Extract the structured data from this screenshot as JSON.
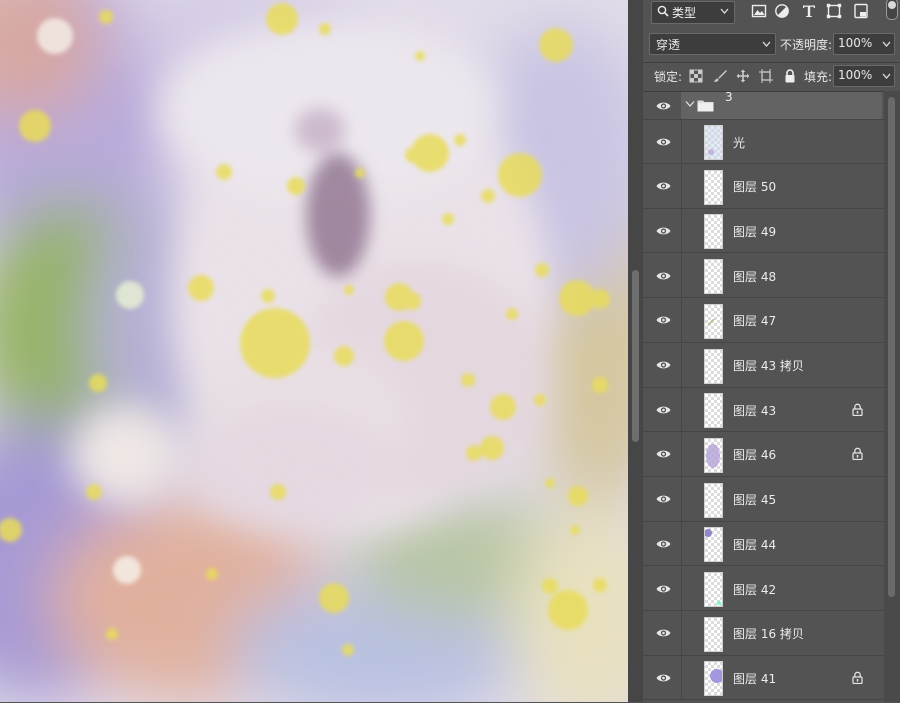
{
  "filter": {
    "label": "类型"
  },
  "blend": {
    "mode": "穿透"
  },
  "opacity": {
    "label": "不透明度:",
    "value": "100%"
  },
  "lock": {
    "label": "锁定:"
  },
  "fill": {
    "label": "填充:",
    "value": "100%"
  },
  "group": {
    "name": "3"
  },
  "layers": [
    {
      "name": "光",
      "locked": false
    },
    {
      "name": "图层 50",
      "locked": false
    },
    {
      "name": "图层 49",
      "locked": false
    },
    {
      "name": "图层 48",
      "locked": false
    },
    {
      "name": "图层 47",
      "locked": false
    },
    {
      "name": "图层 43 拷贝",
      "locked": false
    },
    {
      "name": "图层 43",
      "locked": true
    },
    {
      "name": "图层 46",
      "locked": true
    },
    {
      "name": "图层 45",
      "locked": false
    },
    {
      "name": "图层 44",
      "locked": false
    },
    {
      "name": "图层 42",
      "locked": false
    },
    {
      "name": "图层 16 拷贝",
      "locked": false
    },
    {
      "name": "图层 41",
      "locked": true
    }
  ],
  "colors": {
    "panel": "#535353",
    "field": "#3d3d3d",
    "group_highlight": "#636363",
    "accent_yellow": "#e8dc5a"
  },
  "icons": [
    "search-icon",
    "image-filter-icon",
    "adjustment-filter-icon",
    "type-filter-icon",
    "shape-filter-icon",
    "smart-object-filter-icon",
    "eye-icon",
    "folder-icon",
    "lock-icon"
  ]
}
